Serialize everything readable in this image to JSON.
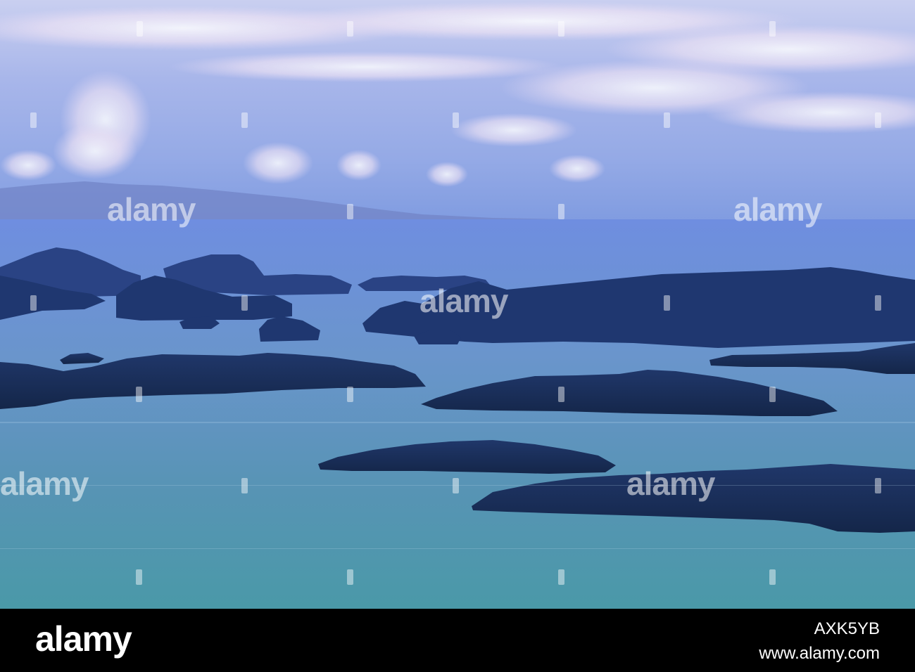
{
  "watermark": {
    "text": "alamy"
  },
  "footer": {
    "logo": "alamy",
    "image_id": "AXK5YB",
    "url": "www.alamy.com"
  },
  "colors": {
    "sky_top": "#bcc6ee",
    "sky_mid": "#9fb2e8",
    "sea_far": "#6f8fdc",
    "sea_near": "#4e94a8",
    "island": "#1a2f5c",
    "footer_bg": "#000000"
  }
}
